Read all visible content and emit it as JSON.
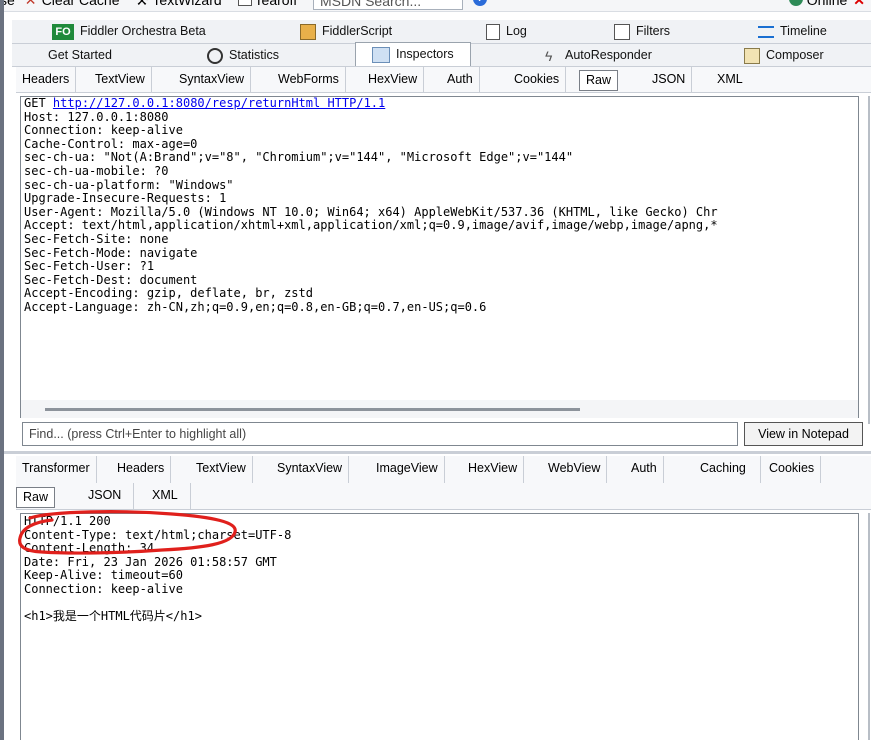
{
  "toolbar": {
    "items": [
      "se",
      "Clear Cache",
      "TextWizard",
      "Tearoff",
      "MSDN Search..."
    ],
    "online": "Online"
  },
  "tabs_row1": [
    "Fiddler Orchestra Beta",
    "FiddlerScript",
    "Log",
    "Filters",
    "Timeline"
  ],
  "tabs_row2": [
    "Get Started",
    "Statistics",
    "Inspectors",
    "AutoResponder",
    "Composer"
  ],
  "request": {
    "subtabs": [
      "Headers",
      "TextView",
      "SyntaxView",
      "WebForms",
      "HexView",
      "Auth",
      "Cookies",
      "Raw",
      "JSON",
      "XML"
    ],
    "selected_subtab": "Raw",
    "method": "GET",
    "url": "http://127.0.0.1:8080/resp/returnHtml HTTP/1.1",
    "lines": [
      "Host: 127.0.0.1:8080",
      "Connection: keep-alive",
      "Cache-Control: max-age=0",
      "sec-ch-ua: \"Not(A:Brand\";v=\"8\", \"Chromium\";v=\"144\", \"Microsoft Edge\";v=\"144\"",
      "sec-ch-ua-mobile: ?0",
      "sec-ch-ua-platform: \"Windows\"",
      "Upgrade-Insecure-Requests: 1",
      "User-Agent: Mozilla/5.0 (Windows NT 10.0; Win64; x64) AppleWebKit/537.36 (KHTML, like Gecko) Chr",
      "Accept: text/html,application/xhtml+xml,application/xml;q=0.9,image/avif,image/webp,image/apng,*",
      "Sec-Fetch-Site: none",
      "Sec-Fetch-Mode: navigate",
      "Sec-Fetch-User: ?1",
      "Sec-Fetch-Dest: document",
      "Accept-Encoding: gzip, deflate, br, zstd",
      "Accept-Language: zh-CN,zh;q=0.9,en;q=0.8,en-GB;q=0.7,en-US;q=0.6"
    ],
    "find_placeholder": "Find... (press Ctrl+Enter to highlight all)",
    "view_in_notepad": "View in Notepad"
  },
  "response": {
    "subtabs_row1": [
      "Transformer",
      "Headers",
      "TextView",
      "SyntaxView",
      "ImageView",
      "HexView",
      "WebView",
      "Auth",
      "Caching",
      "Cookies"
    ],
    "subtabs_row2": [
      "Raw",
      "JSON",
      "XML"
    ],
    "selected_subtab": "Raw",
    "lines": [
      "HTTP/1.1 200",
      "Content-Type: text/html;charset=UTF-8",
      "Content-Length: 34",
      "Date: Fri, 23 Jan 2026 01:58:57 GMT",
      "Keep-Alive: timeout=60",
      "Connection: keep-alive",
      "",
      "<h1>我是一个HTML代码片</h1>"
    ]
  },
  "annotation_color": "#e0201c"
}
